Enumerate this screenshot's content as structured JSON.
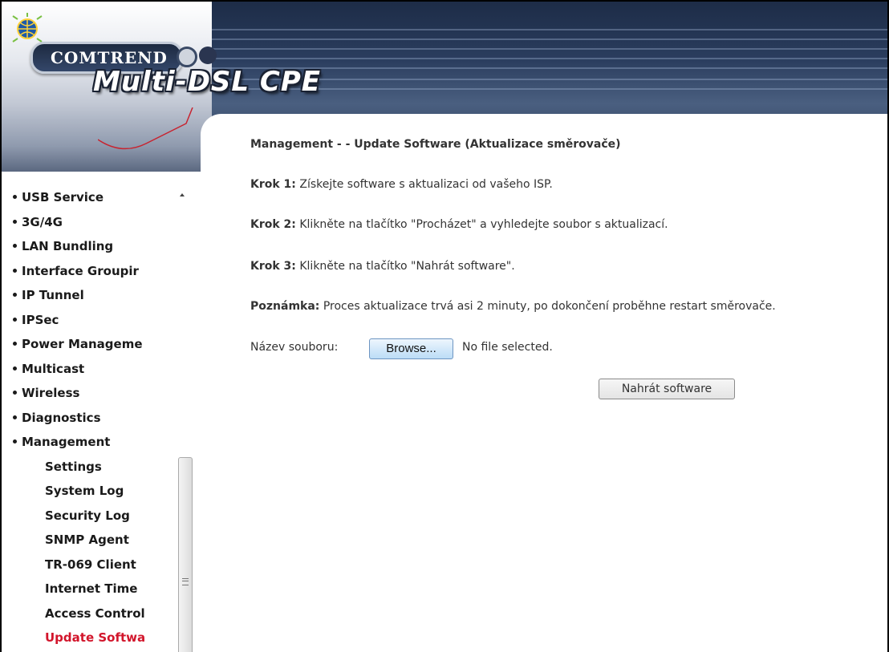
{
  "header": {
    "brand": "COMTREND",
    "product": "Multi-DSL CPE"
  },
  "sidebar": {
    "items": [
      {
        "label": "USB Service",
        "level": 1
      },
      {
        "label": "3G/4G",
        "level": 1
      },
      {
        "label": "LAN Bundling",
        "level": 1
      },
      {
        "label": "Interface Groupir",
        "level": 1
      },
      {
        "label": "IP Tunnel",
        "level": 1
      },
      {
        "label": "IPSec",
        "level": 1
      },
      {
        "label": "Power Manageme",
        "level": 1
      },
      {
        "label": "Multicast",
        "level": 1
      },
      {
        "label": "Wireless",
        "level": 1
      },
      {
        "label": "Diagnostics",
        "level": 1
      },
      {
        "label": "Management",
        "level": 1
      },
      {
        "label": "Settings",
        "level": 2
      },
      {
        "label": "System Log",
        "level": 2
      },
      {
        "label": "Security Log",
        "level": 2
      },
      {
        "label": "SNMP Agent",
        "level": 2
      },
      {
        "label": "TR-069 Client",
        "level": 2
      },
      {
        "label": "Internet Time",
        "level": 2
      },
      {
        "label": "Access Control",
        "level": 2
      },
      {
        "label": "Update Softwa",
        "level": 2,
        "active": true
      }
    ]
  },
  "main": {
    "title": "Management - - Update Software (Aktualizace směrovače)",
    "steps": [
      {
        "label": "Krok 1:",
        "text": " Získejte software s aktualizaci od vašeho ISP."
      },
      {
        "label": "Krok 2:",
        "text": " Klikněte na tlačítko \"Procházet\" a vyhledejte soubor s aktualizací."
      },
      {
        "label": "Krok 3:",
        "text": " Klikněte na tlačítko \"Nahrát software\"."
      },
      {
        "label": "Poznámka:",
        "text": " Proces aktualizace trvá asi 2 minuty, po dokončení proběhne restart směrovače."
      }
    ],
    "file_label": "Název souboru:",
    "browse_label": "Browse...",
    "file_status": "No file selected.",
    "upload_label": "Nahrát software"
  },
  "colors": {
    "active_menu": "#d2152b",
    "browse_button": "#bcdcf6",
    "header_dark": "#2b3e5f"
  }
}
